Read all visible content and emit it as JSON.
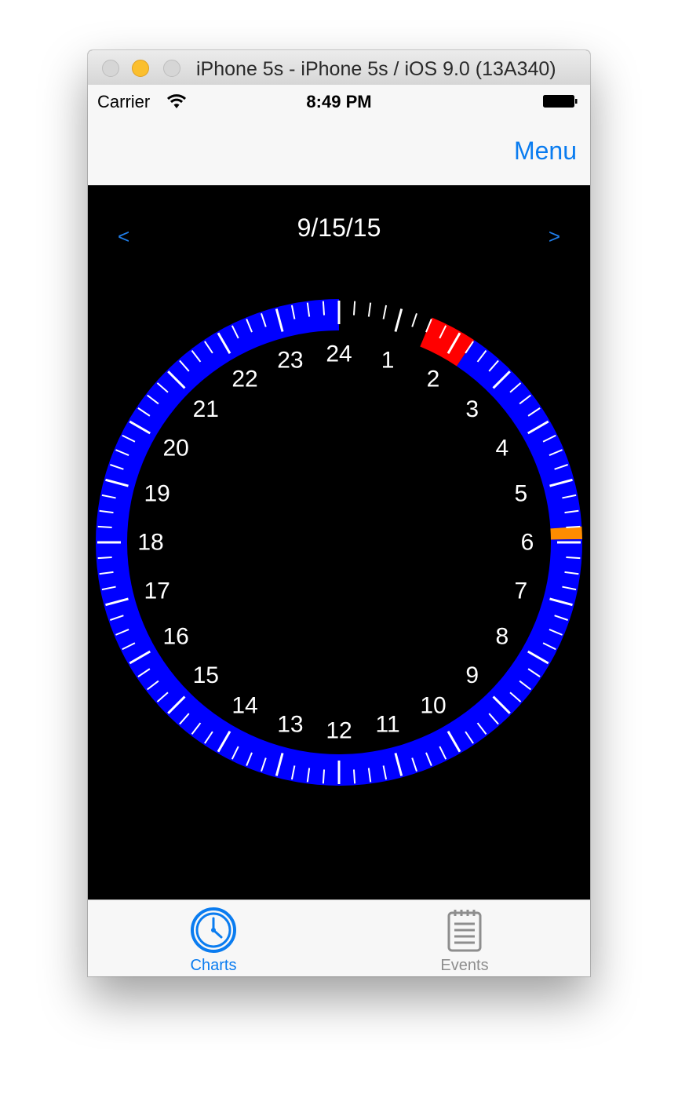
{
  "window": {
    "title": "iPhone 5s - iPhone 5s / iOS 9.0 (13A340)"
  },
  "status_bar": {
    "carrier": "Carrier",
    "time": "8:49 PM",
    "icons": [
      "wifi-icon",
      "battery-icon"
    ]
  },
  "nav_bar": {
    "menu_label": "Menu"
  },
  "chart_header": {
    "date": "9/15/15",
    "prev_label": "<",
    "next_label": ">"
  },
  "chart_data": {
    "type": "radial-clock",
    "hours": [
      "1",
      "2",
      "3",
      "4",
      "5",
      "6",
      "7",
      "8",
      "9",
      "10",
      "11",
      "12",
      "13",
      "14",
      "15",
      "16",
      "17",
      "18",
      "19",
      "20",
      "21",
      "22",
      "23",
      "24"
    ],
    "range_hours": [
      0,
      24
    ],
    "segments": [
      {
        "start_hour": 0.0,
        "end_hour": 1.5,
        "color": "#000000"
      },
      {
        "start_hour": 1.5,
        "end_hour": 2.25,
        "color": "#ff0000"
      },
      {
        "start_hour": 2.25,
        "end_hour": 5.75,
        "color": "#0000ff"
      },
      {
        "start_hour": 5.75,
        "end_hour": 5.95,
        "color": "#ff8c00"
      },
      {
        "start_hour": 5.95,
        "end_hour": 24.0,
        "color": "#0000ff"
      }
    ],
    "tick_color": "#ffffff"
  },
  "colors": {
    "accent": "#0a7cf0",
    "ring": "#0000ff",
    "background": "#000000"
  },
  "tab_bar": {
    "tabs": [
      {
        "label": "Charts",
        "icon": "clock-icon",
        "selected": true
      },
      {
        "label": "Events",
        "icon": "notepad-icon",
        "selected": false
      }
    ]
  }
}
